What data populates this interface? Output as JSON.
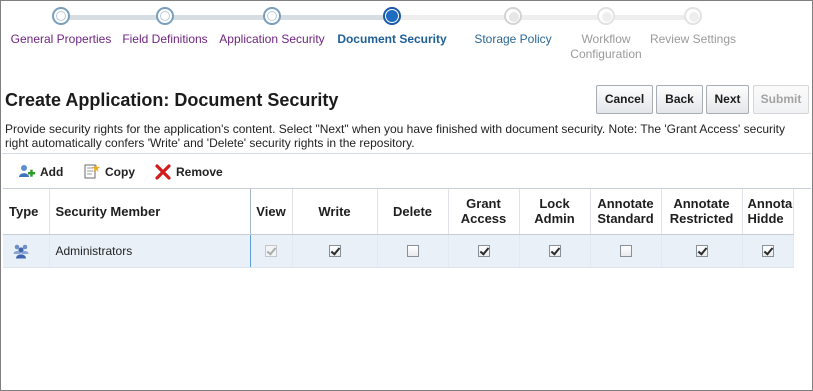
{
  "train": {
    "steps": [
      {
        "label": "General Properties",
        "state": "visited"
      },
      {
        "label": "Field Definitions",
        "state": "visited"
      },
      {
        "label": "Application Security",
        "state": "visited"
      },
      {
        "label": "Document Security",
        "state": "current"
      },
      {
        "label": "Storage Policy",
        "state": "next"
      },
      {
        "label": "Workflow\nConfiguration",
        "state": "future"
      },
      {
        "label": "Review Settings",
        "state": "future"
      }
    ]
  },
  "header": {
    "title": "Create Application: Document Security",
    "buttons": {
      "cancel": "Cancel",
      "back": "Back",
      "next": "Next",
      "submit": "Submit"
    }
  },
  "description": "Provide security rights for the application's content. Select \"Next\" when you have finished with document security. Note: The 'Grant Access' security right automatically confers 'Write' and 'Delete' security rights in the repository.",
  "toolbar": {
    "add": "Add",
    "copy": "Copy",
    "remove": "Remove"
  },
  "table": {
    "columns": [
      "Type",
      "Security Member",
      "View",
      "Write",
      "Delete",
      "Grant\nAccess",
      "Lock\nAdmin",
      "Annotate\nStandard",
      "Annotate\nRestricted",
      "Annota\nHidde"
    ],
    "rows": [
      {
        "type_icon": "group-users-icon",
        "member": "Administrators",
        "view": true,
        "write": true,
        "delete": false,
        "grant_access": true,
        "lock_admin": true,
        "annotate_standard": false,
        "annotate_restricted": true,
        "annotate_hidden": true
      }
    ]
  },
  "colors": {
    "visited_step": "#6f2581",
    "current_step": "#1f5f97",
    "future_step": "#9a9a9a",
    "selected_row": "#e9f0f8",
    "remove_icon": "#d21d1d"
  }
}
